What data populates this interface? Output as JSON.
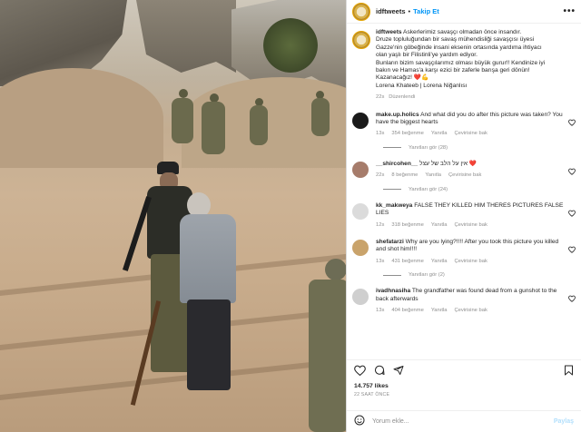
{
  "post": {
    "username": "idftweets",
    "follow_label": "Takip Et",
    "more_label": "•••",
    "caption_lines": [
      "Askerlerimiz savaşçı olmadan önce insandır.",
      "Druze topluluğundan bir savaş mühendisliği savaşçısı üyesi",
      "Gazze'nin göbeğinde insani eksenin ortasında yardıma ihtiyacı",
      "olan yaşlı bir Filistinli'ye yardım ediyor.",
      "Bunların bizim savaşçılarımız olması büyük gurur!! Kendinize iyi",
      "bakın ve Hamas'a karşı ezici bir zaferle barışa geri dönün!",
      "Kazanacağız! ❤️💪",
      "Lorena Khateeb | Lorena Niğanlısı"
    ],
    "caption_time": "22s",
    "caption_edited": "Düzenlendi",
    "likes": "14.757 likes",
    "posted_ago": "22 SAAT ÖNCE",
    "comment_placeholder": "Yorum ekle...",
    "post_label": "Paylaş"
  },
  "comments": [
    {
      "user": "make.up.holics",
      "text": "And what did you do after this picture was taken? You have the biggest hearts",
      "time": "13s",
      "likes": "354 beğenme",
      "reply": "Yanıtla",
      "translate": "Çevirisine bak",
      "replies": "Yanıtları gör (28)",
      "avatar_color": "#1a1a1a"
    },
    {
      "user": "__shircohen__",
      "text": "אין על הלב של עצל ❤️",
      "time": "22s",
      "likes": "8 beğenme",
      "reply": "Yanıtla",
      "translate": "Çevirisine bak",
      "replies": "Yanıtları gör (24)",
      "avatar_color": "#a67c6b"
    },
    {
      "user": "kk_makweya",
      "text": "FALSE THEY KILLED HIM THERES PICTURES FALSE LIES",
      "time": "12s",
      "likes": "318 beğenme",
      "reply": "Yanıtla",
      "translate": "Çevirisine bak",
      "replies": "",
      "avatar_color": "#dbdbdb"
    },
    {
      "user": "shefatarzi",
      "text": "Why are you lying?!!!! After you took this picture you killed and shot him!!!!",
      "time": "13s",
      "likes": "431 beğenme",
      "reply": "Yanıtla",
      "translate": "Çevirisine bak",
      "replies": "Yanıtları gör (2)",
      "avatar_color": "#c9a36b"
    },
    {
      "user": "ivadhnasiha",
      "text": "The grandfather was found dead from a gunshot to the back afterwards",
      "time": "13s",
      "likes": "404 beğenme",
      "reply": "Yanıtla",
      "translate": "Çevirisine bak",
      "replies": "",
      "avatar_color": "#cfcfcf"
    }
  ],
  "colors": {
    "accent": "#0095f6",
    "muted": "#8e8e8e",
    "text": "#262626"
  },
  "icons": [
    "heart-icon",
    "comment-icon",
    "share-icon",
    "bookmark-icon",
    "emoji-icon",
    "more-icon"
  ]
}
